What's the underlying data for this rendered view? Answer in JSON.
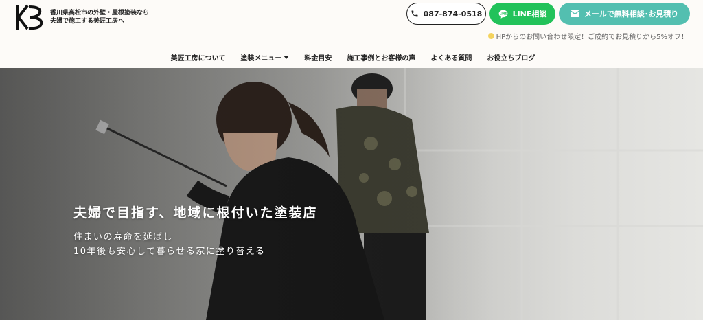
{
  "header": {
    "logo_alt": "KB",
    "tagline_line1": "香川県高松市の外壁・屋根塗装なら",
    "tagline_line2": "夫婦で施工する美匠工房へ"
  },
  "contact": {
    "phone_label": "087-874-0518",
    "line_label": "LINE相談",
    "mail_label": "メールで無料相談･お見積り"
  },
  "promo": {
    "text": "HPからのお問い合わせ限定！ご成約でお見積りから5%オフ！"
  },
  "nav": {
    "items": [
      {
        "label": "美匠工房について"
      },
      {
        "label": "塗装メニュー"
      },
      {
        "label": "料金目安"
      },
      {
        "label": "施工事例とお客様の声"
      },
      {
        "label": "よくある質問"
      },
      {
        "label": "お役立ちブログ"
      }
    ]
  },
  "hero": {
    "title": "夫婦で目指す、地域に根付いた塗装店",
    "sub_line1": "住まいの寿命を延ばし",
    "sub_line2": "10年後も安心して暮らせる家に塗り替える"
  },
  "colors": {
    "line_green": "#22c25a",
    "mail_teal": "#53bfb0",
    "promo_dot": "#f4d35e",
    "background": "#fdfbf8"
  }
}
